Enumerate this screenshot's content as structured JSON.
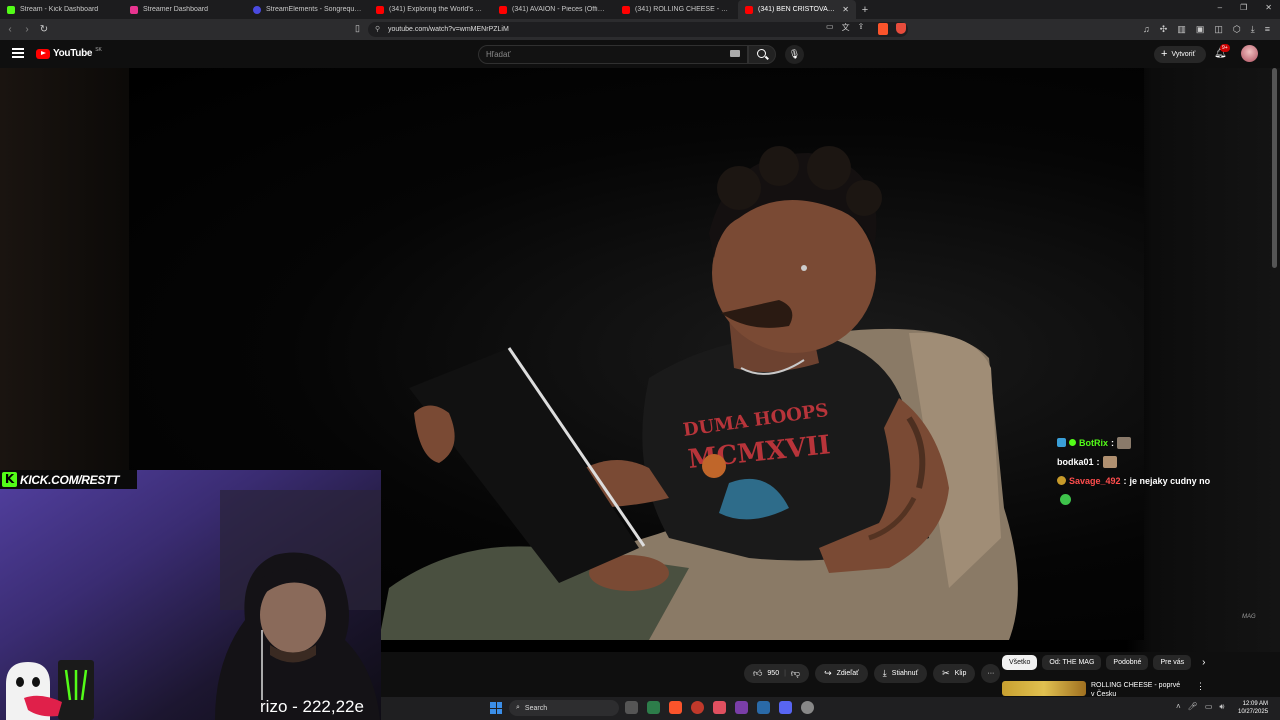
{
  "browser": {
    "tabs": [
      {
        "label": "Stream - Kick Dashboard",
        "color": "#53fc18",
        "active": false
      },
      {
        "label": "Streamer Dashboard",
        "color": "#e8348f",
        "active": false
      },
      {
        "label": "StreamElements - Songrequest",
        "color": "#4a4ae0",
        "active": false
      },
      {
        "label": "(341) Exploring the World's Largest S",
        "color": "#ff0000",
        "active": false
      },
      {
        "label": "(341) AVAION - Pieces (Official Video",
        "color": "#ff0000",
        "active": false
      },
      {
        "label": "(341) ROLLING CHEESE - poprvé v Če",
        "color": "#ff0000",
        "active": false
      },
      {
        "label": "(341) BEN CRISTOVAO vs. AD",
        "color": "#ff0000",
        "active": true
      }
    ],
    "url": "youtube.com/watch?v=wmMENrPZLiM"
  },
  "youtube": {
    "logo_text": "YouTube",
    "region": "SK",
    "search_placeholder": "Hľadať",
    "create_label": "Vytvoriť",
    "notif_badge": "9+",
    "like_count": "950",
    "share_label": "Zdieľať",
    "download_label": "Stiahnuť",
    "clip_label": "Klip",
    "chips": [
      "Všetko",
      "Od: THE MAG",
      "Podobné",
      "Pre vás"
    ],
    "rec_title": "ROLLING CHEESE - poprvé v Česku",
    "watermark": "MAG"
  },
  "stream": {
    "kick_url": "KICK.COM/RESTT",
    "cam_caption": "rizo - 222,22e",
    "chat": [
      {
        "user": "BotRix",
        "sep": ":",
        "msg": "",
        "user_color": "#53fc18"
      },
      {
        "user": "bodka01",
        "sep": ":",
        "msg": "",
        "user_color": "#ffffff"
      },
      {
        "user": "Savage_492",
        "sep": ":",
        "msg": "je nejaky cudny no",
        "user_color": "#ff4d4d"
      }
    ]
  },
  "taskbar": {
    "search_label": "Search",
    "time": "12:09 AM",
    "date": "10/27/2025"
  }
}
